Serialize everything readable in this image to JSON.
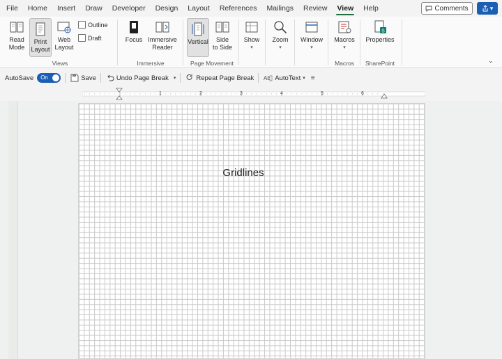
{
  "menubar": {
    "tabs": [
      "File",
      "Home",
      "Insert",
      "Draw",
      "Developer",
      "Design",
      "Layout",
      "References",
      "Mailings",
      "Review",
      "View",
      "Help"
    ],
    "active_tab": "View",
    "comments_label": "Comments"
  },
  "ribbon": {
    "views": {
      "read_mode_line1": "Read",
      "read_mode_line2": "Mode",
      "print_layout_line1": "Print",
      "print_layout_line2": "Layout",
      "web_layout_line1": "Web",
      "web_layout_line2": "Layout",
      "outline": "Outline",
      "draft": "Draft",
      "label": "Views"
    },
    "immersive": {
      "focus": "Focus",
      "immersive_reader_line1": "Immersive",
      "immersive_reader_line2": "Reader",
      "label": "Immersive"
    },
    "page_movement": {
      "vertical": "Vertical",
      "side_to_side_line1": "Side",
      "side_to_side_line2": "to Side",
      "label": "Page Movement"
    },
    "show": "Show",
    "zoom": "Zoom",
    "window": "Window",
    "macros": {
      "button": "Macros",
      "label": "Macros"
    },
    "sharepoint": {
      "button": "Properties",
      "label": "SharePoint"
    }
  },
  "qat": {
    "autosave": "AutoSave",
    "toggle": "On",
    "save": "Save",
    "undo": "Undo Page Break",
    "repeat": "Repeat Page Break",
    "autotext": "AutoText"
  },
  "ruler": {
    "labels": [
      "1",
      "2",
      "3",
      "4",
      "5",
      "6"
    ]
  },
  "document": {
    "text": "Gridlines"
  },
  "colors": {
    "accent": "#1a5fb4",
    "active_tab_underline": "#1f6e3f",
    "gridline": "#c9c9c9"
  }
}
